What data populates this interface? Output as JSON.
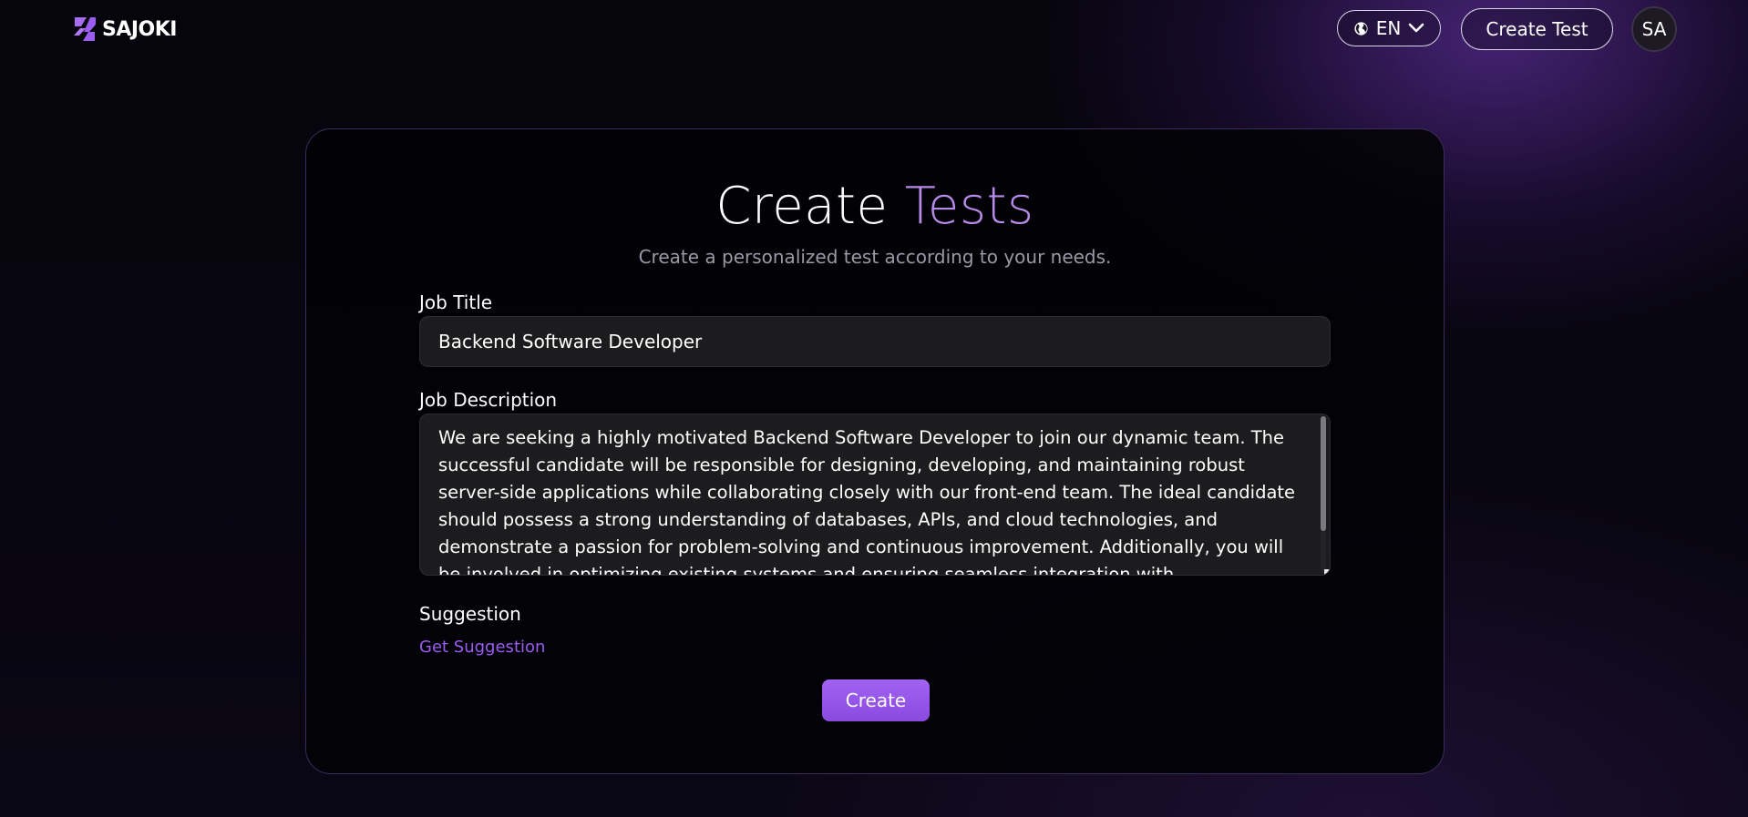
{
  "header": {
    "brand": "SAJOKI",
    "language": {
      "selected": "EN",
      "icon": "globe-icon",
      "dropdown_icon": "chevron-down-icon"
    },
    "create_test_label": "Create Test",
    "avatar_initials": "SA"
  },
  "colors": {
    "accent": "#9b5cf0",
    "title_accent": "#b78ae8",
    "button": "#9a5cf0",
    "background": "#05040c",
    "input_bg": "#1c1c1e"
  },
  "form": {
    "title_part1": "Create",
    "title_part2": "Tests",
    "subtitle": "Create a personalized test according to your needs.",
    "job_title_label": "Job Title",
    "job_title_value": "Backend Software Developer",
    "job_description_label": "Job Description",
    "job_description_value": "We are seeking a highly motivated Backend Software Developer to join our dynamic team. The successful candidate will be responsible for designing, developing, and maintaining robust server-side applications while collaborating closely with our front-end team. The ideal candidate should possess a strong understanding of databases, APIs, and cloud technologies, and demonstrate a passion for problem-solving and continuous improvement. Additionally, you will be involved in optimizing existing systems and ensuring seamless integration with",
    "suggestion_label": "Suggestion",
    "get_suggestion_label": "Get Suggestion",
    "create_label": "Create"
  }
}
